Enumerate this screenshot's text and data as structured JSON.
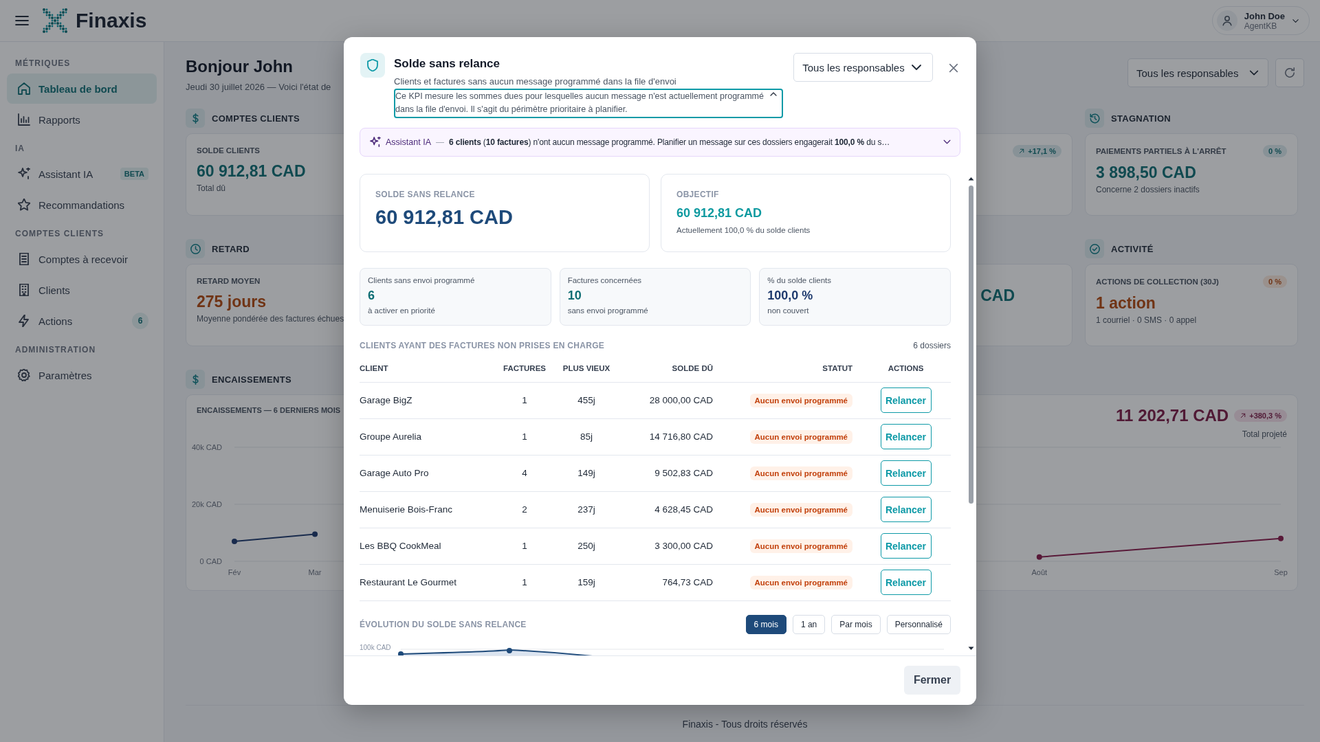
{
  "app": {
    "brand": "Finaxis",
    "user": {
      "name": "John Doe",
      "role": "AgentKB"
    }
  },
  "sidebar": {
    "sections": [
      {
        "title": "MÉTRIQUES",
        "items": [
          {
            "label": "Tableau de bord",
            "kind": "home",
            "selected": true
          },
          {
            "label": "Rapports",
            "kind": "bars",
            "selected": false
          }
        ]
      },
      {
        "title": "IA",
        "items": [
          {
            "label": "Assistant IA",
            "kind": "sparkle",
            "badge": "BETA",
            "selected": false
          },
          {
            "label": "Recommandations",
            "kind": "star",
            "selected": false
          }
        ]
      },
      {
        "title": "COMPTES CLIENTS",
        "items": [
          {
            "label": "Comptes à recevoir",
            "kind": "doc",
            "selected": false
          },
          {
            "label": "Clients",
            "kind": "building",
            "selected": false
          },
          {
            "label": "Actions",
            "kind": "bolt",
            "count": "6",
            "selected": false
          }
        ]
      },
      {
        "title": "ADMINISTRATION",
        "items": [
          {
            "label": "Paramètres",
            "kind": "gear",
            "selected": false
          }
        ]
      }
    ]
  },
  "dashboard": {
    "title": "Bonjour John",
    "subtitle": "Jeudi 30 juillet 2026 — Voici l'état de",
    "filter": "Tous les responsables",
    "rows": [
      {
        "left": {
          "title": "COMPTES CLIENTS",
          "kind": "dollar",
          "cards": [
            {
              "label": "SOLDE CLIENTS",
              "value": "60 912,81 CAD",
              "note": "Total dû"
            },
            {
              "badge": {
                "text": "+17,1 %",
                "arrow": true
              }
            }
          ]
        },
        "right": {
          "title": "STAGNATION",
          "kind": "history",
          "cards": [
            {
              "label": "PAIEMENTS PARTIELS À L'ARRÊT",
              "value": "3 898,50 CAD",
              "note": "Concerne 2 dossiers inactifs",
              "badge": {
                "text": "0 %"
              }
            }
          ]
        }
      },
      {
        "left": {
          "title": "RETARD",
          "kind": "clock",
          "cards": [
            {
              "label": "RETARD MOYEN",
              "value": "275 jours",
              "note": "Moyenne pondérée des factures échues"
            },
            {
              "value": "CAD"
            }
          ]
        },
        "right": {
          "title": "ACTIVITÉ",
          "kind": "check",
          "cards": [
            {
              "label": "ACTIONS DE COLLECTION (30J)",
              "value": "1 action",
              "note": "1 courriel · 0 SMS · 0 appel",
              "badge": {
                "text": "0 %"
              }
            }
          ]
        }
      }
    ],
    "cash": {
      "title": "ENCAISSEMENTS",
      "kind": "dollar",
      "card_title": "ENCAISSEMENTS — 6 DERNIERS MOIS",
      "total": "11 202,71 CAD",
      "badge": {
        "text": "+380,3 %",
        "arrow": true
      },
      "total_note": "Total projeté",
      "chart_data": {
        "type": "line",
        "categories": [
          "Fév",
          "Mar",
          null,
          null,
          null,
          null,
          null,
          null,
          null,
          null,
          "Août",
          null,
          null,
          "Sep"
        ],
        "ylim": [
          0,
          40000
        ],
        "yticks": [
          {
            "value": 0,
            "label": "0 CAD"
          },
          {
            "value": 20000,
            "label": "20k CAD"
          },
          {
            "value": 40000,
            "label": "40k CAD"
          }
        ],
        "series": [
          {
            "color": "#1e3a6e",
            "marker": true,
            "values": [
              7000,
              9500,
              null,
              null,
              null,
              null,
              null,
              null,
              null,
              null,
              null,
              null,
              null,
              null
            ]
          },
          {
            "color": "#8b1a4a",
            "marker": true,
            "values": [
              null,
              null,
              null,
              null,
              null,
              null,
              null,
              null,
              null,
              null,
              1500,
              null,
              null,
              8000
            ]
          }
        ]
      }
    },
    "footer": "Finaxis - Tous droits réservés"
  },
  "modal": {
    "title": "Solde sans relance",
    "subtitle": "Clients et factures sans aucun message programmé dans la file d'envoi",
    "description": {
      "text": "Ce KPI mesure les sommes dues pour lesquelles aucun message n'est actuellement programmé dans la file d'envoi. Il s'agit du périmètre prioritaire à planifier.",
      "expanded": true
    },
    "filter": "Tous les responsables",
    "assistant": {
      "label": "Assistant IA",
      "separator": "—",
      "message": "**6 clients** (**10 factures**) n'ont aucun message programmé. Planifier un message sur ces dossiers engagerait **100,0 %** du s…",
      "expanded": false
    },
    "kpis": [
      {
        "kind": "main",
        "label": "SOLDE SANS RELANCE",
        "value": "60 912,81 CAD"
      },
      {
        "kind": "target",
        "label": "OBJECTIF",
        "value": "60 912,81 CAD",
        "note": "Actuellement 100,0 % du solde clients"
      }
    ],
    "stats": [
      {
        "label": "Clients sans envoi programmé",
        "value": "6",
        "note": "à activer en priorité",
        "color": "#0f6e74"
      },
      {
        "label": "Factures concernées",
        "value": "10",
        "note": "sans envoi programmé",
        "color": "#0f6e74"
      },
      {
        "label": "% du solde clients",
        "value": "100,0 %",
        "note": "non couvert",
        "color": "#1e3a6e"
      }
    ],
    "table": {
      "title": "CLIENTS AYANT DES FACTURES NON PRISES EN CHARGE",
      "count": "6 dossiers",
      "columns": [
        "CLIENT",
        "FACTURES",
        "PLUS VIEUX",
        "SOLDE DÛ",
        "STATUT",
        "ACTIONS"
      ],
      "rows": [
        {
          "client": "Garage BigZ",
          "invoices": "1",
          "oldest": "455j",
          "balance": "28 000,00 CAD",
          "status": "Aucun envoi programmé",
          "action": "Relancer"
        },
        {
          "client": "Groupe Aurelia",
          "invoices": "1",
          "oldest": "85j",
          "balance": "14 716,80 CAD",
          "status": "Aucun envoi programmé",
          "action": "Relancer"
        },
        {
          "client": "Garage Auto Pro",
          "invoices": "4",
          "oldest": "149j",
          "balance": "9 502,83 CAD",
          "status": "Aucun envoi programmé",
          "action": "Relancer"
        },
        {
          "client": "Menuiserie Bois-Franc",
          "invoices": "2",
          "oldest": "237j",
          "balance": "4 628,45 CAD",
          "status": "Aucun envoi programmé",
          "action": "Relancer"
        },
        {
          "client": "Les BBQ CookMeal",
          "invoices": "1",
          "oldest": "250j",
          "balance": "3 300,00 CAD",
          "status": "Aucun envoi programmé",
          "action": "Relancer"
        },
        {
          "client": "Restaurant Le Gourmet",
          "invoices": "1",
          "oldest": "159j",
          "balance": "764,73 CAD",
          "status": "Aucun envoi programmé",
          "action": "Relancer"
        }
      ]
    },
    "evolution": {
      "title": "ÉVOLUTION DU SOLDE SANS RELANCE",
      "ranges": [
        {
          "label": "6 mois",
          "selected": true
        },
        {
          "label": "1 an",
          "selected": false
        },
        {
          "label": "Par mois",
          "selected": false
        },
        {
          "label": "Personnalisé",
          "selected": false
        }
      ],
      "y_label": "100k CAD"
    },
    "close_button": "Fermer"
  }
}
